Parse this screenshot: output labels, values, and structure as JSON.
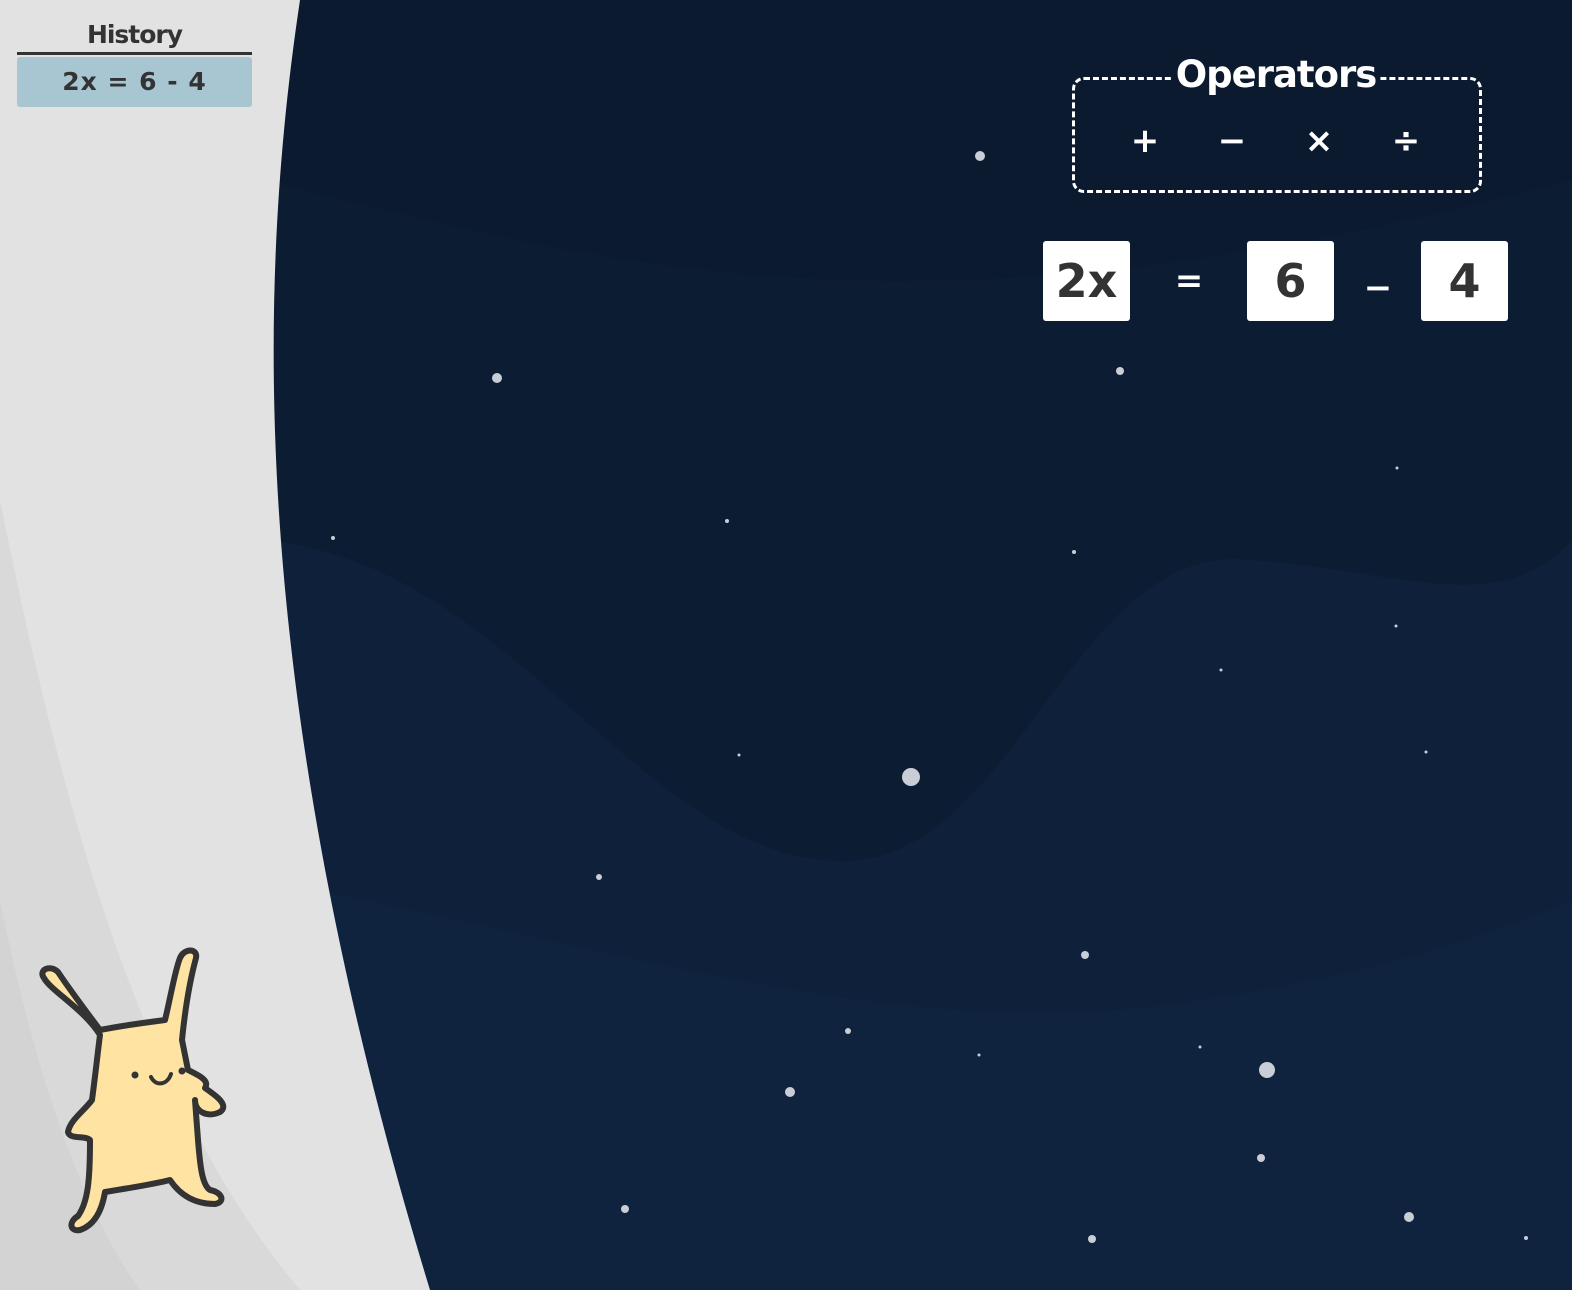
{
  "history": {
    "title": "History",
    "items": [
      "2x = 6 - 4"
    ]
  },
  "operators": {
    "title": "Operators",
    "symbols": [
      "+",
      "−",
      "×",
      "÷"
    ]
  },
  "equation": {
    "tiles": [
      "2x",
      "6",
      "4"
    ],
    "equals": "=",
    "operator": "−"
  },
  "colors": {
    "space_background": "#0b1a2e",
    "history_panel": "#e2e2e2",
    "history_item": "#a7c6d2",
    "tile": "#ffffff",
    "mascot": "#ffe3a3",
    "text_dark": "#333333"
  }
}
